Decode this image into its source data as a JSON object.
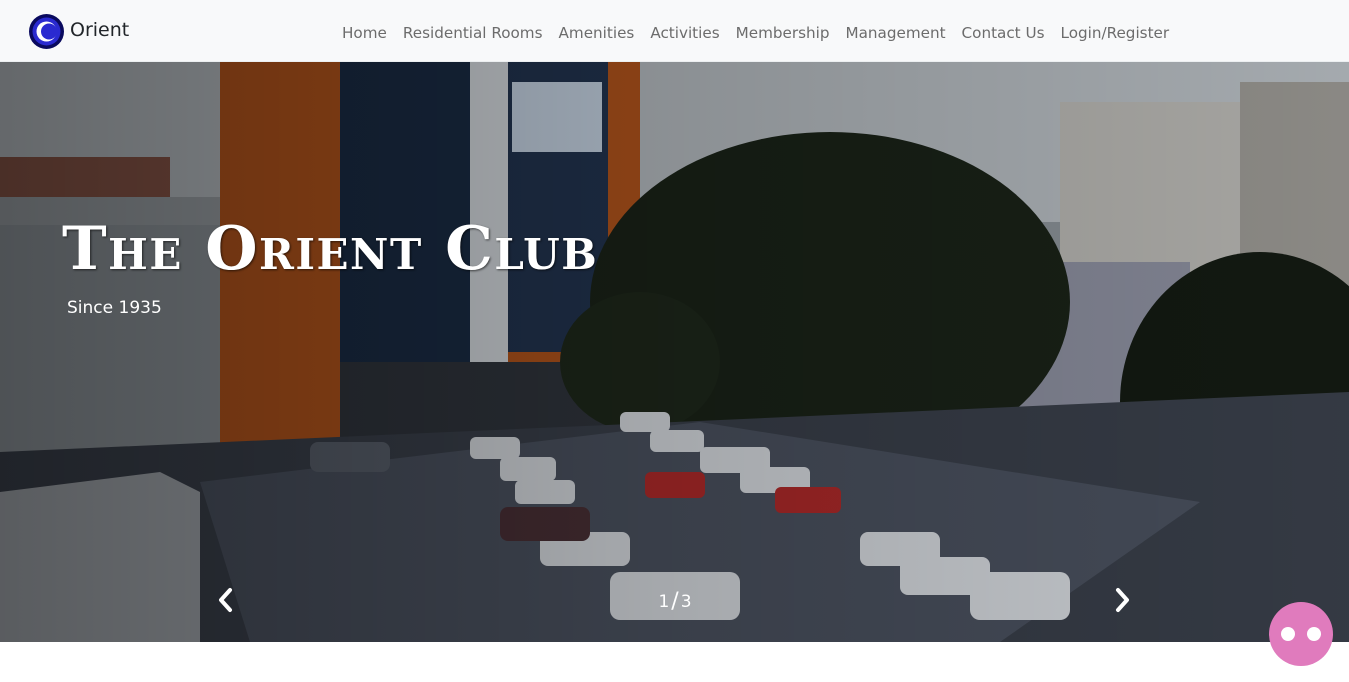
{
  "navbar": {
    "brand_name": "Orient",
    "links": [
      "Home",
      "Residential Rooms",
      "Amenities",
      "Activities",
      "Membership",
      "Management",
      "Contact Us",
      "Login/Register"
    ]
  },
  "hero": {
    "title": "The Orient Club",
    "subtitle": "Since 1935",
    "current_slide": "1",
    "total_slides": "3",
    "prev_icon": "chevron-left-icon",
    "next_icon": "chevron-right-icon"
  },
  "chat": {
    "icon": "chat-bubble-icon"
  },
  "colors": {
    "navbar_bg": "#f8f9fa",
    "nav_text": "#6c6c6c",
    "logo_ring": "#1a1a8c",
    "chat_button": "#e07bbd"
  }
}
